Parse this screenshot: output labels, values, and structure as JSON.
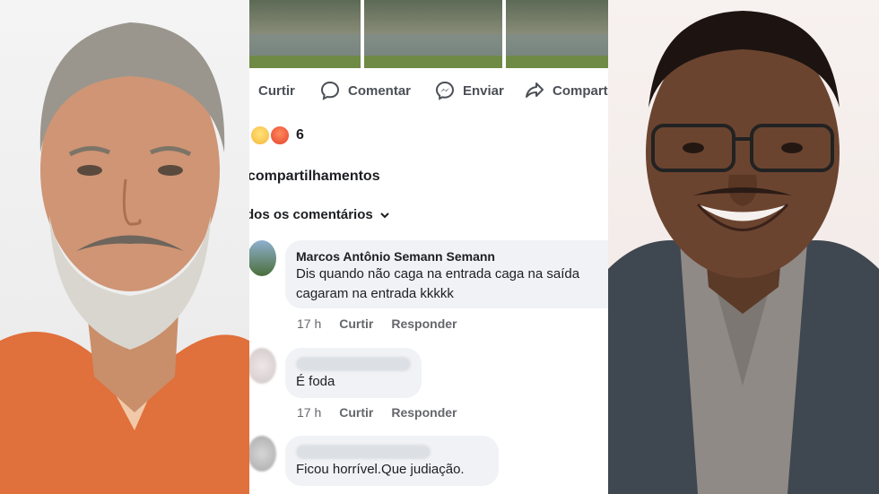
{
  "post_actions": {
    "like": "Curtir",
    "comment": "Comentar",
    "send": "Enviar",
    "share": "Compart"
  },
  "reactions": {
    "count": "6",
    "emojis": [
      "sad-emoji",
      "angry-emoji"
    ]
  },
  "shares_label": "compartilhamentos",
  "all_comments_label": "dos os comentários",
  "comments": [
    {
      "author": "Marcos Antônio Semann Semann",
      "text_lines": [
        "Dis quando não caga na entrada caga na saída",
        "cagaram na entrada kkkkk"
      ],
      "time": "17 h",
      "like": "Curtir",
      "reply": "Responder"
    },
    {
      "author": "",
      "text_lines": [
        "É foda"
      ],
      "time": "17 h",
      "like": "Curtir",
      "reply": "Responder"
    },
    {
      "author": "",
      "text_lines": [
        "Ficou horrível.Que  judiação."
      ]
    }
  ],
  "colors": {
    "bubble": "#f0f2f5",
    "meta_text": "#65676b",
    "left_shirt": "#e0703c",
    "right_jacket": "#3f4750"
  }
}
